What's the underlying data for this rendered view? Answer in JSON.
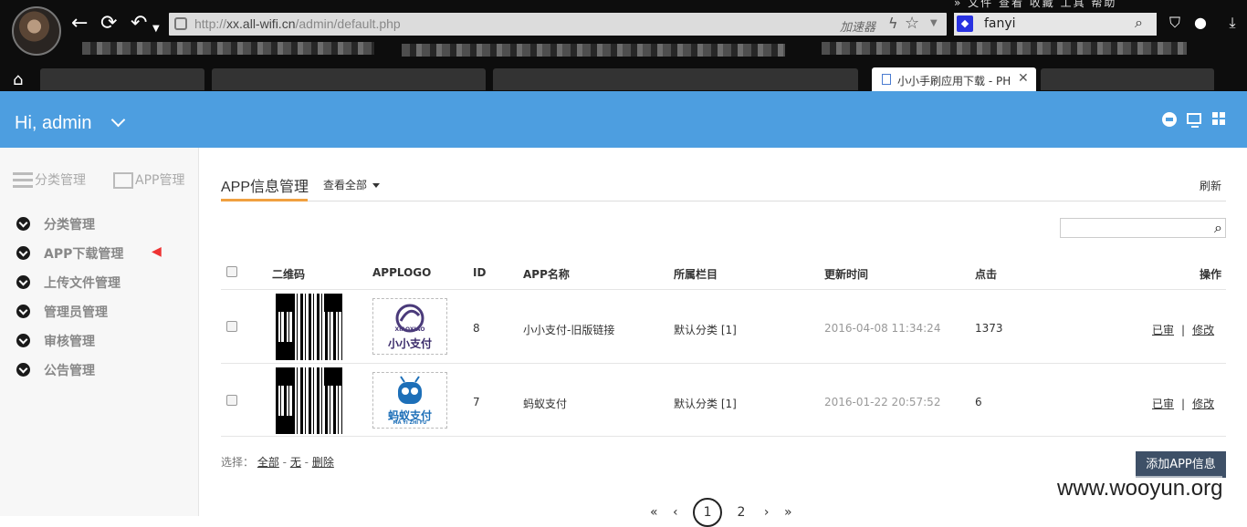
{
  "browser": {
    "url_prefix": "http://",
    "url_domain": "xx.all-wifi.cn",
    "url_path": "/admin/default.php",
    "accelerator": "加速器",
    "search_query": "fanyi",
    "menu_text": "»  文件  查看  收藏  工具  帮助",
    "active_tab_title": "小小手刷应用下载 - PH"
  },
  "header": {
    "greeting": "Hi, admin"
  },
  "sidebar": {
    "tabs": [
      "分类管理",
      "APP管理"
    ],
    "items": [
      {
        "label": "分类管理"
      },
      {
        "label": "APP下载管理"
      },
      {
        "label": "上传文件管理"
      },
      {
        "label": "管理员管理"
      },
      {
        "label": "审核管理"
      },
      {
        "label": "公告管理"
      }
    ]
  },
  "main": {
    "title": "APP信息管理",
    "filter": "查看全部",
    "refresh": "刷新",
    "columns": [
      "二维码",
      "APPLOGO",
      "ID",
      "APP名称",
      "所属栏目",
      "更新时间",
      "点击",
      "操作"
    ],
    "rows": [
      {
        "id": "8",
        "name": "小小支付-旧版链接",
        "category": "默认分类 [1]",
        "updated": "2016-04-08 11:34:24",
        "clicks": "1373",
        "logo_text": "小小支付",
        "logo_sub": "XIAOXIAO",
        "action1": "已审",
        "action2": "修改"
      },
      {
        "id": "7",
        "name": "蚂蚁支付",
        "category": "默认分类 [1]",
        "updated": "2016-01-22 20:57:52",
        "clicks": "6",
        "logo_text": "蚂蚁支付",
        "logo_sub": "MA YI ZHI FU",
        "action1": "已审",
        "action2": "修改"
      }
    ],
    "select_label": "选择：",
    "select_all": "全部",
    "select_none": "无",
    "delete": "删除",
    "add_button": "添加APP信息",
    "pager": {
      "first": "«",
      "prev": "‹",
      "current": "1",
      "next_page": "2",
      "next": "›",
      "last": "»"
    }
  },
  "watermark": "www.wooyun.org",
  "colors": {
    "header_bg": "#4d9ee0",
    "accent": "#f0a040",
    "button": "#3e5067"
  }
}
